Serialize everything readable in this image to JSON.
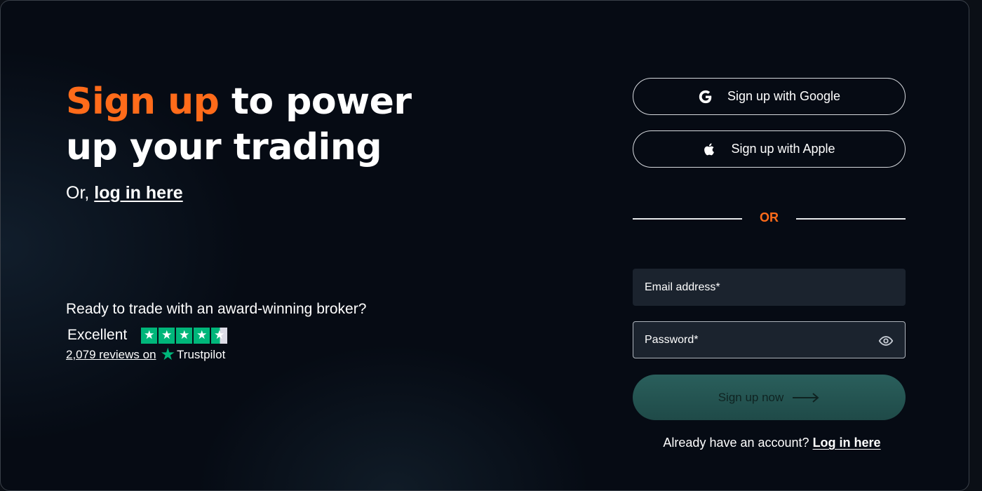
{
  "headline": {
    "accent": "Sign up",
    "rest_line1": " to power",
    "line2": "up your trading"
  },
  "login_prompt": {
    "prefix": "Or, ",
    "link": "log in here"
  },
  "trust": {
    "question": "Ready to trade with an award-winning broker?",
    "rating_word": "Excellent",
    "rating_stars": 4.5,
    "reviews_link": "2,079 reviews on",
    "provider": "Trustpilot",
    "brand_color": "#00b67a"
  },
  "oauth": {
    "google_label": "Sign up with Google",
    "google_icon": "google-icon",
    "apple_label": "Sign up with Apple",
    "apple_icon": "apple-icon"
  },
  "divider": {
    "label": "OR"
  },
  "form": {
    "email_label": "Email address*",
    "password_label": "Password*",
    "password_toggle_icon": "eye-icon",
    "submit_label": "Sign up now",
    "submit_icon": "arrow-right-icon"
  },
  "footer": {
    "prefix": "Already have an account? ",
    "link": "Log in here"
  },
  "colors": {
    "accent": "#ff6b1a",
    "background": "#060b14",
    "submit": "#2a5f5c"
  }
}
